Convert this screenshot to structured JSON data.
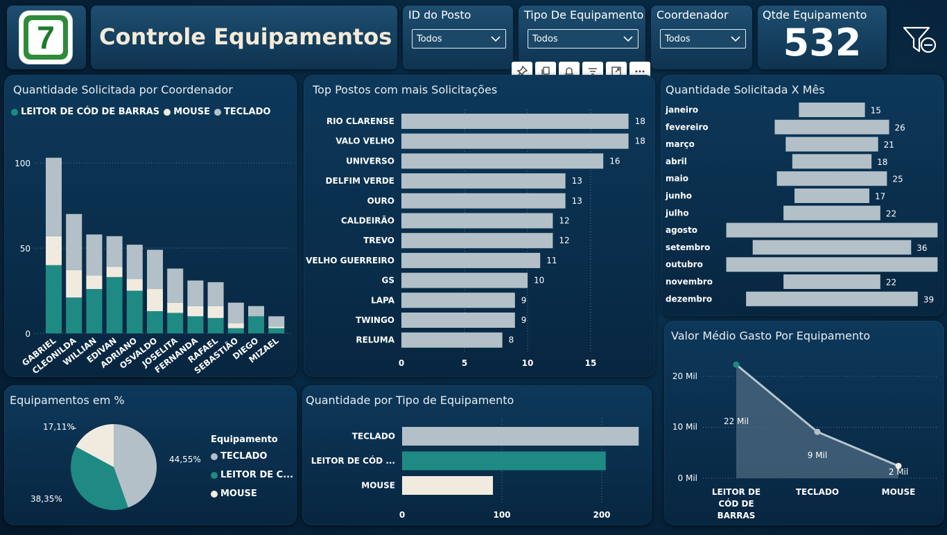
{
  "header": {
    "logo_text": "7",
    "title": "Controle Equipamentos",
    "slicers": [
      {
        "label": "ID do Posto",
        "value": "Todos"
      },
      {
        "label": "Tipo De Equipamento",
        "value": "Todos"
      },
      {
        "label": "Coordenador",
        "value": "Todos"
      }
    ],
    "kpi": {
      "label": "Qtde Equipamento",
      "value": "532"
    }
  },
  "colors": {
    "teal": "#1e8a83",
    "cream": "#f1ebdf",
    "gray": "#b3c0c8"
  },
  "icons": [
    "pin-icon",
    "copy-icon",
    "bell-icon",
    "filter-icon",
    "focus-mode-icon",
    "more-options-icon",
    "clear-filter-icon",
    "chevron-down-icon"
  ],
  "charts": {
    "coordenador": {
      "title": "Quantidade Solicitada por Coordenador",
      "legend": [
        "LEITOR DE CÓD DE BARRAS",
        "MOUSE",
        "TECLADO"
      ],
      "y_ticks": [
        "100",
        "50",
        "0"
      ]
    },
    "postos": {
      "title": "Top Postos com mais Solicitações",
      "x_ticks": [
        "0",
        "5",
        "10",
        "15"
      ]
    },
    "mes": {
      "title": "Quantidade Solicitada X Mês"
    },
    "percent": {
      "title": "Equipamentos em %",
      "legend_title": "Equipamento",
      "legend": [
        "TECLADO",
        "LEITOR DE C...",
        "MOUSE"
      ],
      "labels": [
        "44,55%",
        "38,35%",
        "17,11%"
      ]
    },
    "tipo": {
      "title": "Quantidade por Tipo de Equipamento",
      "x_ticks": [
        "0",
        "100",
        "200"
      ]
    },
    "valor": {
      "title": "Valor Médio Gasto Por Equipamento",
      "y_ticks": [
        "20 Mil",
        "10 Mil",
        "0 Mil"
      ]
    }
  },
  "chart_data": [
    {
      "type": "bar",
      "stacked": true,
      "title": "Quantidade Solicitada por Coordenador",
      "categories": [
        "GABRIEL",
        "CLEONILDA",
        "WILLIAN",
        "EDIVAN",
        "ADRIANO",
        "OSVALDO",
        "JOSELITA",
        "FERNANDA",
        "RAFAEL",
        "SEBASTIÃO",
        "DIEGO",
        "MIZAEL"
      ],
      "series": [
        {
          "name": "LEITOR DE CÓD DE BARRAS",
          "color": "#1e8a83",
          "values": [
            40,
            21,
            26,
            33,
            25,
            13,
            12,
            10,
            9,
            3,
            10,
            3
          ]
        },
        {
          "name": "MOUSE",
          "color": "#f1ebdf",
          "values": [
            17,
            16,
            8,
            6,
            7,
            13,
            6,
            6,
            7,
            3,
            0,
            1
          ]
        },
        {
          "name": "TECLADO",
          "color": "#b3c0c8",
          "values": [
            46,
            33,
            24,
            18,
            20,
            23,
            20,
            15,
            14,
            12,
            6,
            6
          ]
        }
      ],
      "ylim": [
        0,
        110
      ],
      "legend_position": "top-left"
    },
    {
      "type": "bar",
      "orientation": "horizontal",
      "title": "Top Postos com mais Solicitações",
      "categories": [
        "RIO CLARENSE",
        "VALO VELHO",
        "UNIVERSO",
        "DELFIM VERDE",
        "OURO",
        "CALDEIRÃO",
        "TREVO",
        "VELHO GUERREIRO",
        "GS",
        "LAPA",
        "TWINGO",
        "RELUMA"
      ],
      "values": [
        18,
        18,
        16,
        13,
        13,
        12,
        12,
        11,
        10,
        9,
        9,
        8
      ],
      "xlim": [
        0,
        20
      ]
    },
    {
      "type": "bar",
      "orientation": "horizontal-funnel",
      "title": "Quantidade Solicitada X Mês",
      "categories": [
        "janeiro",
        "fevereiro",
        "março",
        "abril",
        "maio",
        "junho",
        "julho",
        "agosto",
        "setembro",
        "outubro",
        "novembro",
        "dezembro"
      ],
      "values": [
        15,
        26,
        21,
        18,
        25,
        17,
        22,
        48,
        36,
        48,
        22,
        39
      ],
      "labels": [
        "15",
        "26",
        "21",
        "18",
        "25",
        "17",
        "22",
        "",
        "36",
        "",
        "22",
        "39"
      ]
    },
    {
      "type": "pie",
      "title": "Equipamentos em %",
      "categories": [
        "TECLADO",
        "LEITOR DE C...",
        "MOUSE"
      ],
      "values": [
        44.55,
        38.35,
        17.11
      ],
      "colors": [
        "#b3c0c8",
        "#1e8a83",
        "#f1ebdf"
      ],
      "legend_position": "right"
    },
    {
      "type": "bar",
      "orientation": "horizontal",
      "title": "Quantidade por Tipo de Equipamento",
      "categories": [
        "TECLADO",
        "LEITOR DE CÓD ...",
        "MOUSE"
      ],
      "values": [
        237,
        204,
        91
      ],
      "colors": [
        "#b3c0c8",
        "#1e8a83",
        "#f1ebdf"
      ],
      "xlim": [
        0,
        240
      ]
    },
    {
      "type": "area",
      "title": "Valor Médio Gasto Por Equipamento",
      "categories": [
        "LEITOR DE CÓD DE BARRAS",
        "TECLADO",
        "MOUSE"
      ],
      "values": [
        22300,
        9100,
        2400
      ],
      "labels": [
        "22 Mil",
        "9 Mil",
        "2 Mil"
      ],
      "ylim": [
        0,
        25000
      ]
    }
  ]
}
